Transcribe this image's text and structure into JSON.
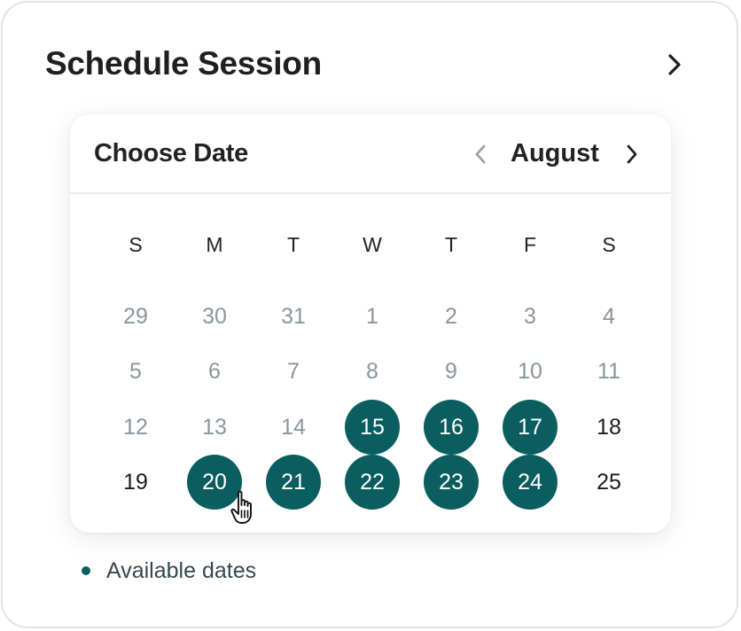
{
  "header": {
    "title": "Schedule Session",
    "next_icon": "chevron-right-icon"
  },
  "calendar": {
    "title": "Choose Date",
    "month": "August",
    "prev_icon": "chevron-left-icon",
    "next_icon": "chevron-right-icon",
    "weekdays": [
      "S",
      "M",
      "T",
      "W",
      "T",
      "F",
      "S"
    ],
    "weeks": [
      [
        {
          "label": "29",
          "state": "muted"
        },
        {
          "label": "30",
          "state": "muted"
        },
        {
          "label": "31",
          "state": "muted"
        },
        {
          "label": "1",
          "state": "muted"
        },
        {
          "label": "2",
          "state": "muted"
        },
        {
          "label": "3",
          "state": "muted"
        },
        {
          "label": "4",
          "state": "muted"
        }
      ],
      [
        {
          "label": "5",
          "state": "muted"
        },
        {
          "label": "6",
          "state": "muted"
        },
        {
          "label": "7",
          "state": "muted"
        },
        {
          "label": "8",
          "state": "muted"
        },
        {
          "label": "9",
          "state": "muted"
        },
        {
          "label": "10",
          "state": "muted"
        },
        {
          "label": "11",
          "state": "muted"
        }
      ],
      [
        {
          "label": "12",
          "state": "muted"
        },
        {
          "label": "13",
          "state": "muted"
        },
        {
          "label": "14",
          "state": "muted"
        },
        {
          "label": "15",
          "state": "available"
        },
        {
          "label": "16",
          "state": "available"
        },
        {
          "label": "17",
          "state": "available"
        },
        {
          "label": "18",
          "state": "normal"
        }
      ],
      [
        {
          "label": "19",
          "state": "normal"
        },
        {
          "label": "20",
          "state": "available"
        },
        {
          "label": "21",
          "state": "available"
        },
        {
          "label": "22",
          "state": "available"
        },
        {
          "label": "23",
          "state": "available"
        },
        {
          "label": "24",
          "state": "available"
        },
        {
          "label": "25",
          "state": "normal"
        }
      ]
    ],
    "pointer_icon": "hand-pointer-icon"
  },
  "legend": {
    "label": "Available dates",
    "dot_icon": "dot-icon"
  },
  "colors": {
    "available": "#0b5e5f",
    "muted_text": "#8a969c",
    "text": "#1c1c1c"
  }
}
